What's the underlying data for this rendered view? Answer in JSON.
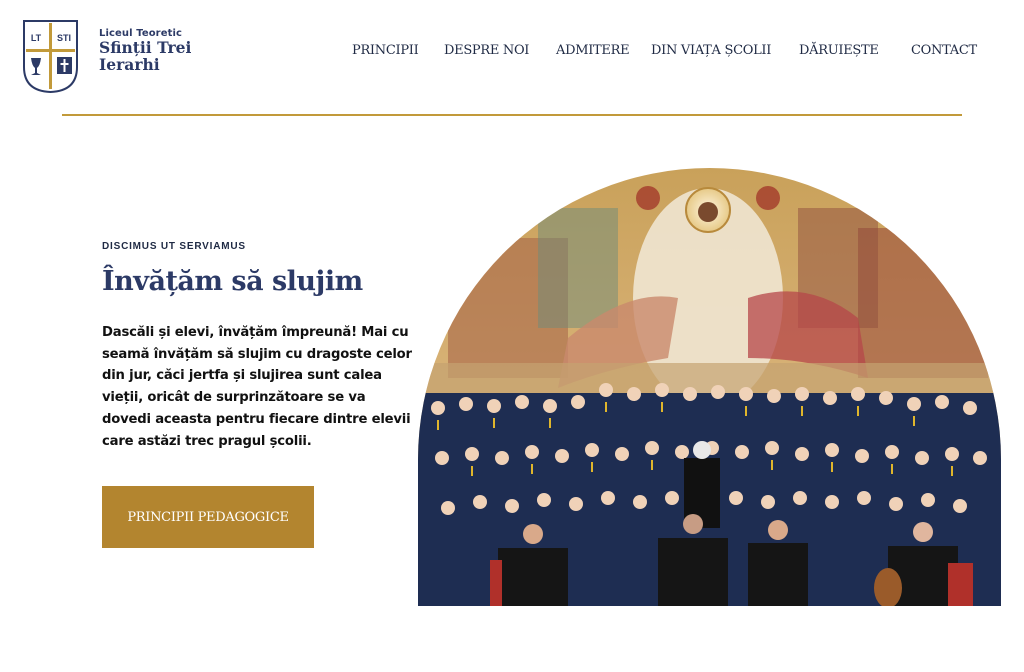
{
  "brand": {
    "logo_letters_left": "LT",
    "logo_letters_right": "STI",
    "school_type": "Liceul Teoretic",
    "name_line1": "Sfinții Trei",
    "name_line2": "Ierarhi",
    "accent_color": "#c29a3a",
    "navy_color": "#2c3a66"
  },
  "nav": {
    "items": [
      {
        "label": "PRINCIPII"
      },
      {
        "label": "DESPRE NOI"
      },
      {
        "label": "ADMITERE"
      },
      {
        "label": "DIN VIAȚA ȘCOLII"
      },
      {
        "label": "DĂRUIEȘTE"
      },
      {
        "label": "CONTACT"
      }
    ]
  },
  "hero": {
    "motto": "DISCIMUS UT SERVIAMUS",
    "title": "Învățăm să slujim",
    "body": "Dascăli și elevi, învățăm împreună! Mai cu seamă învățăm să slujim cu dragoste celor din jur, căci jertfa și slujirea sunt calea vieții, oricât de surprinzătoare se va dovedi aceasta pentru fiecare dintre elevii care astăzi trec pragul școlii.",
    "button_label": "PRINCIPII PEDAGOGICE",
    "button_color": "#b3852f",
    "image": "choir-photo-with-icon-fresco"
  }
}
